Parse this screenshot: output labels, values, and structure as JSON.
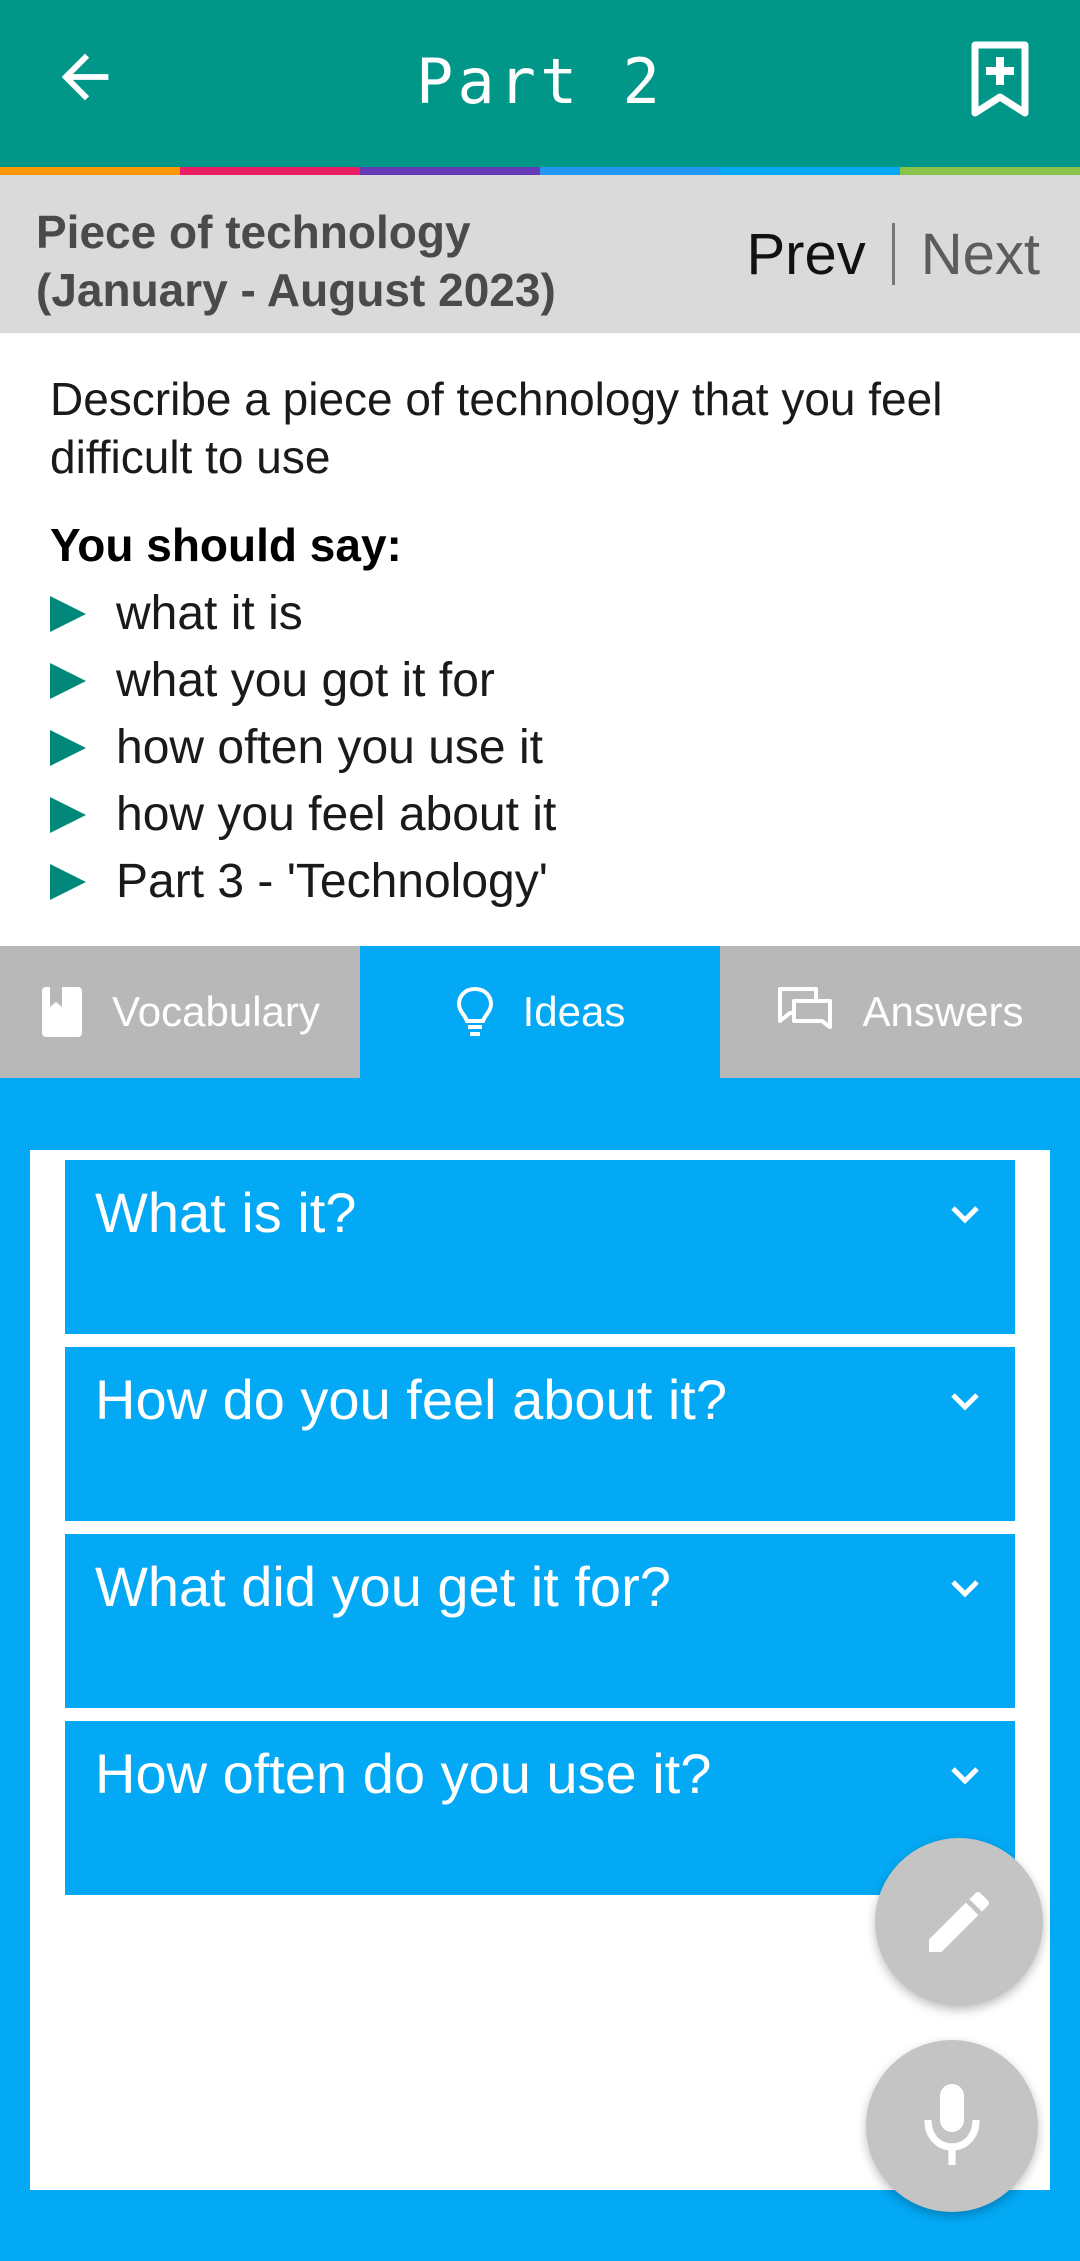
{
  "header": {
    "title": "Part 2"
  },
  "stripe_colors": [
    "#ff9800",
    "#e91e63",
    "#673ab7",
    "#2196f3",
    "#03a9f4",
    "#8bc34a"
  ],
  "topic": {
    "title_line1": "Piece of technology",
    "title_line2": "(January - August 2023)",
    "prev_label": "Prev",
    "next_label": "Next"
  },
  "prompt": {
    "line1": "Describe a piece of technology that you feel",
    "line2": "difficult to use",
    "should_say": "You should say:",
    "bullets": [
      "what it is",
      "what you got it for",
      "how often you use it",
      "how you feel about it",
      "Part 3 -  'Technology'"
    ]
  },
  "tabs": [
    {
      "label": "Vocabulary",
      "icon": "book-icon",
      "active": false
    },
    {
      "label": "Ideas",
      "icon": "lightbulb-icon",
      "active": true
    },
    {
      "label": "Answers",
      "icon": "chat-icon",
      "active": false
    }
  ],
  "accordion": [
    {
      "title": "What is it?"
    },
    {
      "title": "How do you feel about it?"
    },
    {
      "title": "What did you get it for?"
    },
    {
      "title": "How often do you use it?"
    }
  ],
  "fabs": {
    "edit_icon": "pencil-icon",
    "mic_icon": "microphone-icon"
  },
  "colors": {
    "app_bar": "#009688",
    "accent_blue": "#03a9f4",
    "tab_inactive": "#b8b8b8",
    "bullet": "#00897b"
  }
}
